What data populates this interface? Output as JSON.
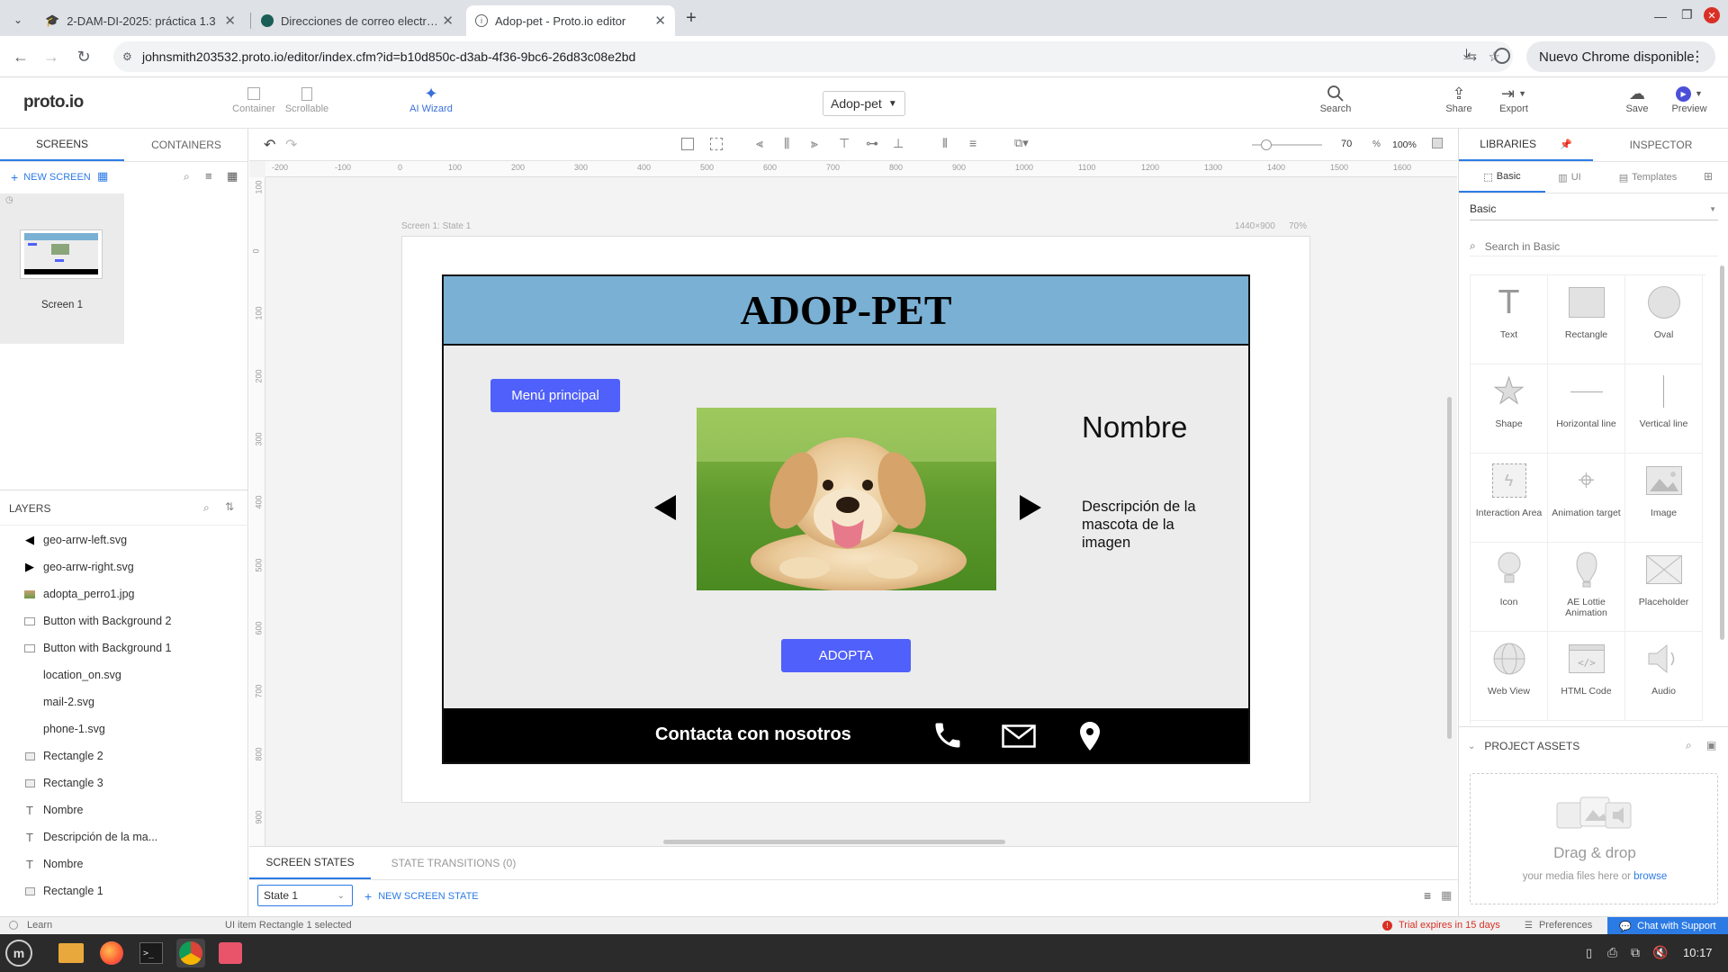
{
  "browser": {
    "tabs": [
      {
        "title": "2-DAM-DI-2025: práctica 1.3",
        "icon": "graduation-cap-icon"
      },
      {
        "title": "Direcciones de correo electr…",
        "icon": "mail-site-icon"
      },
      {
        "title": "Adop-pet - Proto.io editor",
        "icon": "info-icon",
        "active": true
      }
    ],
    "url": "johnsmith203532.proto.io/editor/index.cfm?id=b10d850c-d3ab-4f36-9bc6-26d83c08e2bd",
    "update_button": "Nuevo Chrome disponible"
  },
  "toolbar": {
    "logo": "proto.io",
    "container": "Container",
    "scrollable": "Scrollable",
    "ai_wizard": "AI Wizard",
    "project": "Adop-pet",
    "search": "Search",
    "share": "Share",
    "export": "Export",
    "save": "Save",
    "preview": "Preview"
  },
  "left_panel": {
    "tabs": [
      "SCREENS",
      "CONTAINERS"
    ],
    "new_screen": "NEW SCREEN",
    "screen_name": "Screen 1",
    "layers_title": "LAYERS",
    "layers": [
      {
        "name": "geo-arrw-left.svg",
        "icon": "triangle-left-icon"
      },
      {
        "name": "geo-arrw-right.svg",
        "icon": "triangle-right-icon"
      },
      {
        "name": "adopta_perro1.jpg",
        "icon": "image-icon"
      },
      {
        "name": "Button with Background 2",
        "icon": "button-icon"
      },
      {
        "name": "Button with Background 1",
        "icon": "button-icon"
      },
      {
        "name": "location_on.svg",
        "icon": "none"
      },
      {
        "name": "mail-2.svg",
        "icon": "none"
      },
      {
        "name": "phone-1.svg",
        "icon": "none"
      },
      {
        "name": "Rectangle 2",
        "icon": "rectangle-icon"
      },
      {
        "name": "Rectangle 3",
        "icon": "rectangle-icon"
      },
      {
        "name": "Nombre",
        "icon": "text-icon"
      },
      {
        "name": "Descripción de la ma...",
        "icon": "text-icon"
      },
      {
        "name": "Nombre",
        "icon": "text-icon"
      },
      {
        "name": "Rectangle 1",
        "icon": "rectangle-icon"
      }
    ]
  },
  "canvas": {
    "zoom_value": "70",
    "zoom_pct": "%",
    "zoom_100": "100%",
    "ruler_h": [
      "-200",
      "-100",
      "0",
      "100",
      "200",
      "300",
      "400",
      "500",
      "600",
      "700",
      "800",
      "900",
      "1000",
      "1100",
      "1200",
      "1300",
      "1400",
      "1500",
      "1600"
    ],
    "ruler_v": [
      "100",
      "0",
      "100",
      "200",
      "300",
      "400",
      "500",
      "600",
      "700",
      "800",
      "900"
    ],
    "screen_label": "Screen 1: State 1",
    "screen_size": "1440×900",
    "screen_zoom": "70%"
  },
  "mockup": {
    "title": "ADOP-PET",
    "menu_button": "Menú principal",
    "name": "Nombre",
    "description": "Descripción de la mascota de la imagen",
    "adopt_button": "ADOPTA",
    "footer_text": "Contacta con nosotros",
    "colors": {
      "header": "#7ab0d3",
      "button": "#5060fa",
      "footer": "#000000",
      "body": "#ececec"
    }
  },
  "right_panel": {
    "tabs": [
      "LIBRARIES",
      "INSPECTOR"
    ],
    "subtabs": [
      "Basic",
      "UI",
      "Templates"
    ],
    "library": "Basic",
    "search_placeholder": "Search in Basic",
    "components": [
      {
        "label": "Text",
        "icon": "text-t-icon"
      },
      {
        "label": "Rectangle",
        "icon": "rectangle-icon"
      },
      {
        "label": "Oval",
        "icon": "oval-icon"
      },
      {
        "label": "Shape",
        "icon": "star-icon"
      },
      {
        "label": "Horizontal line",
        "icon": "hline-icon"
      },
      {
        "label": "Vertical line",
        "icon": "vline-icon"
      },
      {
        "label": "Interaction Area",
        "icon": "lightning-icon"
      },
      {
        "label": "Animation target",
        "icon": "target-icon"
      },
      {
        "label": "Image",
        "icon": "image-icon"
      },
      {
        "label": "Icon",
        "icon": "lightbulb-icon"
      },
      {
        "label": "AE Lottie Animation",
        "icon": "lottie-icon"
      },
      {
        "label": "Placeholder",
        "icon": "placeholder-icon"
      },
      {
        "label": "Web View",
        "icon": "globe-icon"
      },
      {
        "label": "HTML Code",
        "icon": "code-icon"
      },
      {
        "label": "Audio",
        "icon": "speaker-icon"
      }
    ],
    "assets_title": "PROJECT ASSETS",
    "drag_drop": "Drag & drop",
    "drag_hint": "your media files here or",
    "browse": "browse"
  },
  "states": {
    "tabs": [
      "SCREEN STATES",
      "STATE TRANSITIONS (0)"
    ],
    "current": "State 1",
    "new_state": "NEW SCREEN STATE"
  },
  "status": {
    "learn": "Learn",
    "message": "UI item Rectangle 1 selected",
    "trial": "Trial expires in 15 days",
    "preferences": "Preferences",
    "chat": "Chat with Support"
  },
  "taskbar": {
    "time": "10:17"
  }
}
